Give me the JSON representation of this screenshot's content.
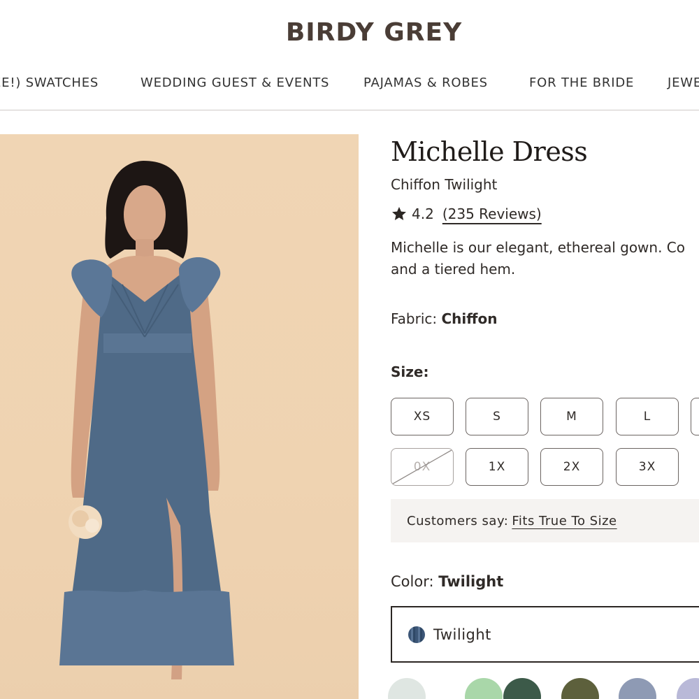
{
  "brand": {
    "logo": "BIRDY GREY"
  },
  "nav": {
    "items": [
      {
        "label": "EE!) SWATCHES"
      },
      {
        "label": "WEDDING GUEST & EVENTS"
      },
      {
        "label": "PAJAMAS & ROBES"
      },
      {
        "label": "FOR THE BRIDE"
      },
      {
        "label": "JEWE"
      }
    ]
  },
  "product": {
    "title": "Michelle Dress",
    "subtitle": "Chiffon Twilight",
    "rating": "4.2",
    "reviews_label": "(235 Reviews)",
    "description_line1": "Michelle is our elegant, ethereal gown. Co",
    "description_line2": "and a tiered hem.",
    "fabric_label": "Fabric: ",
    "fabric_value": "Chiffon",
    "size_label": "Size:",
    "sizes": [
      {
        "label": "XS",
        "available": true
      },
      {
        "label": "S",
        "available": true
      },
      {
        "label": "M",
        "available": true
      },
      {
        "label": "L",
        "available": true
      },
      {
        "label": "0X",
        "available": false
      },
      {
        "label": "1X",
        "available": true
      },
      {
        "label": "2X",
        "available": true
      },
      {
        "label": "3X",
        "available": true
      }
    ],
    "fit_prefix": "Customers say:",
    "fit_value": "Fits True To Size",
    "color_label": "Color: ",
    "color_value": "Twilight",
    "selected_color": "Twilight",
    "swatches": [
      {
        "name": "light-sage",
        "color": "#dfe6e2"
      },
      {
        "name": "mint",
        "color": "#a9d7a9"
      },
      {
        "name": "emerald",
        "color": "#3c5a49"
      },
      {
        "name": "olive",
        "color": "#5d603c"
      },
      {
        "name": "slate-blue",
        "color": "#8e9ab4"
      },
      {
        "name": "lavender",
        "color": "#b9b9d8"
      }
    ]
  },
  "colors": {
    "accent": "#4a3d36",
    "image_background": "#efd3b1",
    "dress": "#4f6a87"
  }
}
